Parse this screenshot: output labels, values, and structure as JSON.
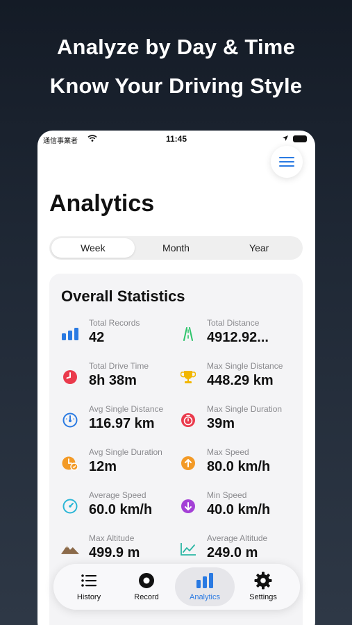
{
  "headline": {
    "line1": "Analyze by Day & Time",
    "line2": "Know Your Driving Style"
  },
  "status_bar": {
    "carrier": "通信事業者",
    "time": "11:45"
  },
  "page": {
    "title": "Analytics"
  },
  "segments": {
    "items": [
      "Week",
      "Month",
      "Year"
    ],
    "selected": "Week"
  },
  "overall": {
    "title": "Overall Statistics",
    "stats": [
      {
        "label": "Total Records",
        "value": "42",
        "icon": "bar-chart-icon"
      },
      {
        "label": "Total Distance",
        "value": "4912.92...",
        "icon": "road-icon"
      },
      {
        "label": "Total Drive Time",
        "value": "8h 38m",
        "icon": "clock-icon"
      },
      {
        "label": "Max Single Distance",
        "value": "448.29 km",
        "icon": "trophy-icon"
      },
      {
        "label": "Avg Single Distance",
        "value": "116.97 km",
        "icon": "speedometer-icon"
      },
      {
        "label": "Max Single Duration",
        "value": "39m",
        "icon": "timer-icon"
      },
      {
        "label": "Avg Single Duration",
        "value": "12m",
        "icon": "duration-icon"
      },
      {
        "label": "Max Speed",
        "value": "80.0 km/h",
        "icon": "arrow-up-circle-icon"
      },
      {
        "label": "Average Speed",
        "value": "60.0 km/h",
        "icon": "gauge-icon"
      },
      {
        "label": "Min Speed",
        "value": "40.0 km/h",
        "icon": "arrow-down-circle-icon"
      },
      {
        "label": "Max Altitude",
        "value": "499.9 m",
        "icon": "mountain-icon"
      },
      {
        "label": "Average Altitude",
        "value": "249.0 m",
        "icon": "trend-chart-icon"
      }
    ]
  },
  "tabbar": {
    "items": [
      {
        "label": "History",
        "icon": "list-icon"
      },
      {
        "label": "Record",
        "icon": "record-icon"
      },
      {
        "label": "Analytics",
        "icon": "bar-chart-icon"
      },
      {
        "label": "Settings",
        "icon": "gear-icon"
      }
    ],
    "active": "Analytics"
  },
  "colors": {
    "accent": "#2a7ae2",
    "green": "#2ec46b",
    "red": "#ea3a4c",
    "gold": "#f2b600",
    "orange": "#f39a26",
    "cyan": "#2bb6d6",
    "purple": "#a440d6",
    "brown": "#8b6a4a"
  }
}
